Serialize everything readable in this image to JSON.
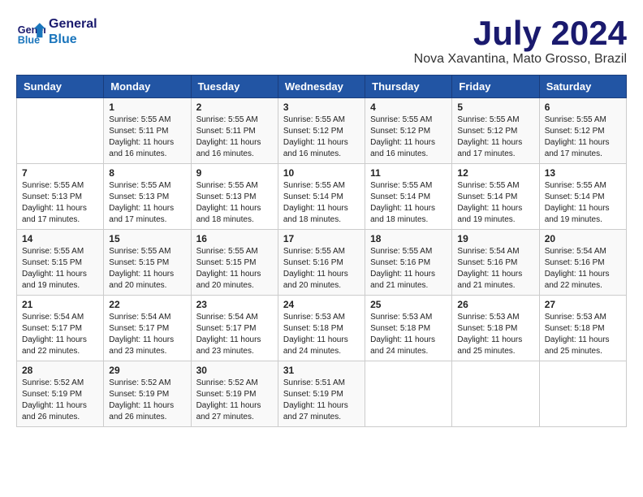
{
  "logo": {
    "line1": "General",
    "line2": "Blue"
  },
  "title": "July 2024",
  "subtitle": "Nova Xavantina, Mato Grosso, Brazil",
  "days": [
    "Sunday",
    "Monday",
    "Tuesday",
    "Wednesday",
    "Thursday",
    "Friday",
    "Saturday"
  ],
  "weeks": [
    [
      {
        "day": "",
        "content": ""
      },
      {
        "day": "1",
        "content": "Sunrise: 5:55 AM\nSunset: 5:11 PM\nDaylight: 11 hours\nand 16 minutes."
      },
      {
        "day": "2",
        "content": "Sunrise: 5:55 AM\nSunset: 5:11 PM\nDaylight: 11 hours\nand 16 minutes."
      },
      {
        "day": "3",
        "content": "Sunrise: 5:55 AM\nSunset: 5:12 PM\nDaylight: 11 hours\nand 16 minutes."
      },
      {
        "day": "4",
        "content": "Sunrise: 5:55 AM\nSunset: 5:12 PM\nDaylight: 11 hours\nand 16 minutes."
      },
      {
        "day": "5",
        "content": "Sunrise: 5:55 AM\nSunset: 5:12 PM\nDaylight: 11 hours\nand 17 minutes."
      },
      {
        "day": "6",
        "content": "Sunrise: 5:55 AM\nSunset: 5:12 PM\nDaylight: 11 hours\nand 17 minutes."
      }
    ],
    [
      {
        "day": "7",
        "content": "Sunrise: 5:55 AM\nSunset: 5:13 PM\nDaylight: 11 hours\nand 17 minutes."
      },
      {
        "day": "8",
        "content": "Sunrise: 5:55 AM\nSunset: 5:13 PM\nDaylight: 11 hours\nand 17 minutes."
      },
      {
        "day": "9",
        "content": "Sunrise: 5:55 AM\nSunset: 5:13 PM\nDaylight: 11 hours\nand 18 minutes."
      },
      {
        "day": "10",
        "content": "Sunrise: 5:55 AM\nSunset: 5:14 PM\nDaylight: 11 hours\nand 18 minutes."
      },
      {
        "day": "11",
        "content": "Sunrise: 5:55 AM\nSunset: 5:14 PM\nDaylight: 11 hours\nand 18 minutes."
      },
      {
        "day": "12",
        "content": "Sunrise: 5:55 AM\nSunset: 5:14 PM\nDaylight: 11 hours\nand 19 minutes."
      },
      {
        "day": "13",
        "content": "Sunrise: 5:55 AM\nSunset: 5:14 PM\nDaylight: 11 hours\nand 19 minutes."
      }
    ],
    [
      {
        "day": "14",
        "content": "Sunrise: 5:55 AM\nSunset: 5:15 PM\nDaylight: 11 hours\nand 19 minutes."
      },
      {
        "day": "15",
        "content": "Sunrise: 5:55 AM\nSunset: 5:15 PM\nDaylight: 11 hours\nand 20 minutes."
      },
      {
        "day": "16",
        "content": "Sunrise: 5:55 AM\nSunset: 5:15 PM\nDaylight: 11 hours\nand 20 minutes."
      },
      {
        "day": "17",
        "content": "Sunrise: 5:55 AM\nSunset: 5:16 PM\nDaylight: 11 hours\nand 20 minutes."
      },
      {
        "day": "18",
        "content": "Sunrise: 5:55 AM\nSunset: 5:16 PM\nDaylight: 11 hours\nand 21 minutes."
      },
      {
        "day": "19",
        "content": "Sunrise: 5:54 AM\nSunset: 5:16 PM\nDaylight: 11 hours\nand 21 minutes."
      },
      {
        "day": "20",
        "content": "Sunrise: 5:54 AM\nSunset: 5:16 PM\nDaylight: 11 hours\nand 22 minutes."
      }
    ],
    [
      {
        "day": "21",
        "content": "Sunrise: 5:54 AM\nSunset: 5:17 PM\nDaylight: 11 hours\nand 22 minutes."
      },
      {
        "day": "22",
        "content": "Sunrise: 5:54 AM\nSunset: 5:17 PM\nDaylight: 11 hours\nand 23 minutes."
      },
      {
        "day": "23",
        "content": "Sunrise: 5:54 AM\nSunset: 5:17 PM\nDaylight: 11 hours\nand 23 minutes."
      },
      {
        "day": "24",
        "content": "Sunrise: 5:53 AM\nSunset: 5:18 PM\nDaylight: 11 hours\nand 24 minutes."
      },
      {
        "day": "25",
        "content": "Sunrise: 5:53 AM\nSunset: 5:18 PM\nDaylight: 11 hours\nand 24 minutes."
      },
      {
        "day": "26",
        "content": "Sunrise: 5:53 AM\nSunset: 5:18 PM\nDaylight: 11 hours\nand 25 minutes."
      },
      {
        "day": "27",
        "content": "Sunrise: 5:53 AM\nSunset: 5:18 PM\nDaylight: 11 hours\nand 25 minutes."
      }
    ],
    [
      {
        "day": "28",
        "content": "Sunrise: 5:52 AM\nSunset: 5:19 PM\nDaylight: 11 hours\nand 26 minutes."
      },
      {
        "day": "29",
        "content": "Sunrise: 5:52 AM\nSunset: 5:19 PM\nDaylight: 11 hours\nand 26 minutes."
      },
      {
        "day": "30",
        "content": "Sunrise: 5:52 AM\nSunset: 5:19 PM\nDaylight: 11 hours\nand 27 minutes."
      },
      {
        "day": "31",
        "content": "Sunrise: 5:51 AM\nSunset: 5:19 PM\nDaylight: 11 hours\nand 27 minutes."
      },
      {
        "day": "",
        "content": ""
      },
      {
        "day": "",
        "content": ""
      },
      {
        "day": "",
        "content": ""
      }
    ]
  ]
}
